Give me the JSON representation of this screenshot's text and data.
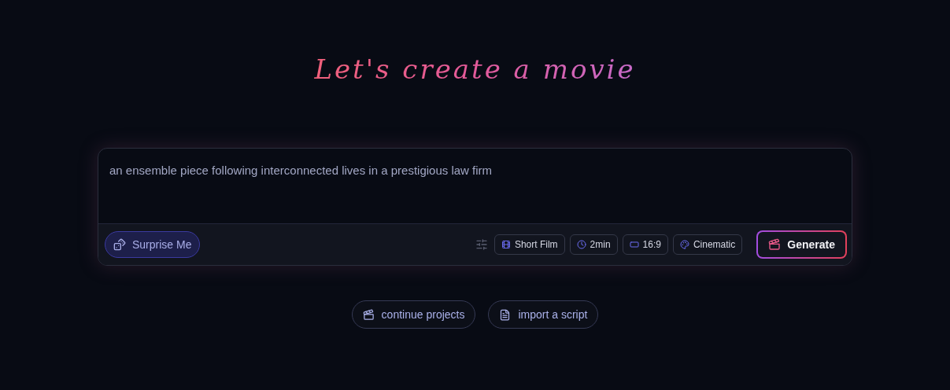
{
  "title": "Let's create a movie",
  "prompt": {
    "value": "an ensemble piece following interconnected lives in a prestigious law firm"
  },
  "surprise_button": {
    "label": "Surprise Me"
  },
  "options": [
    {
      "kind": "format",
      "label": "Short Film"
    },
    {
      "kind": "duration",
      "label": "2min"
    },
    {
      "kind": "ratio",
      "label": "16:9"
    },
    {
      "kind": "style",
      "label": "Cinematic"
    }
  ],
  "generate_button": {
    "label": "Generate"
  },
  "links": [
    {
      "kind": "projects",
      "label": "continue projects"
    },
    {
      "kind": "script",
      "label": "import a script"
    }
  ]
}
